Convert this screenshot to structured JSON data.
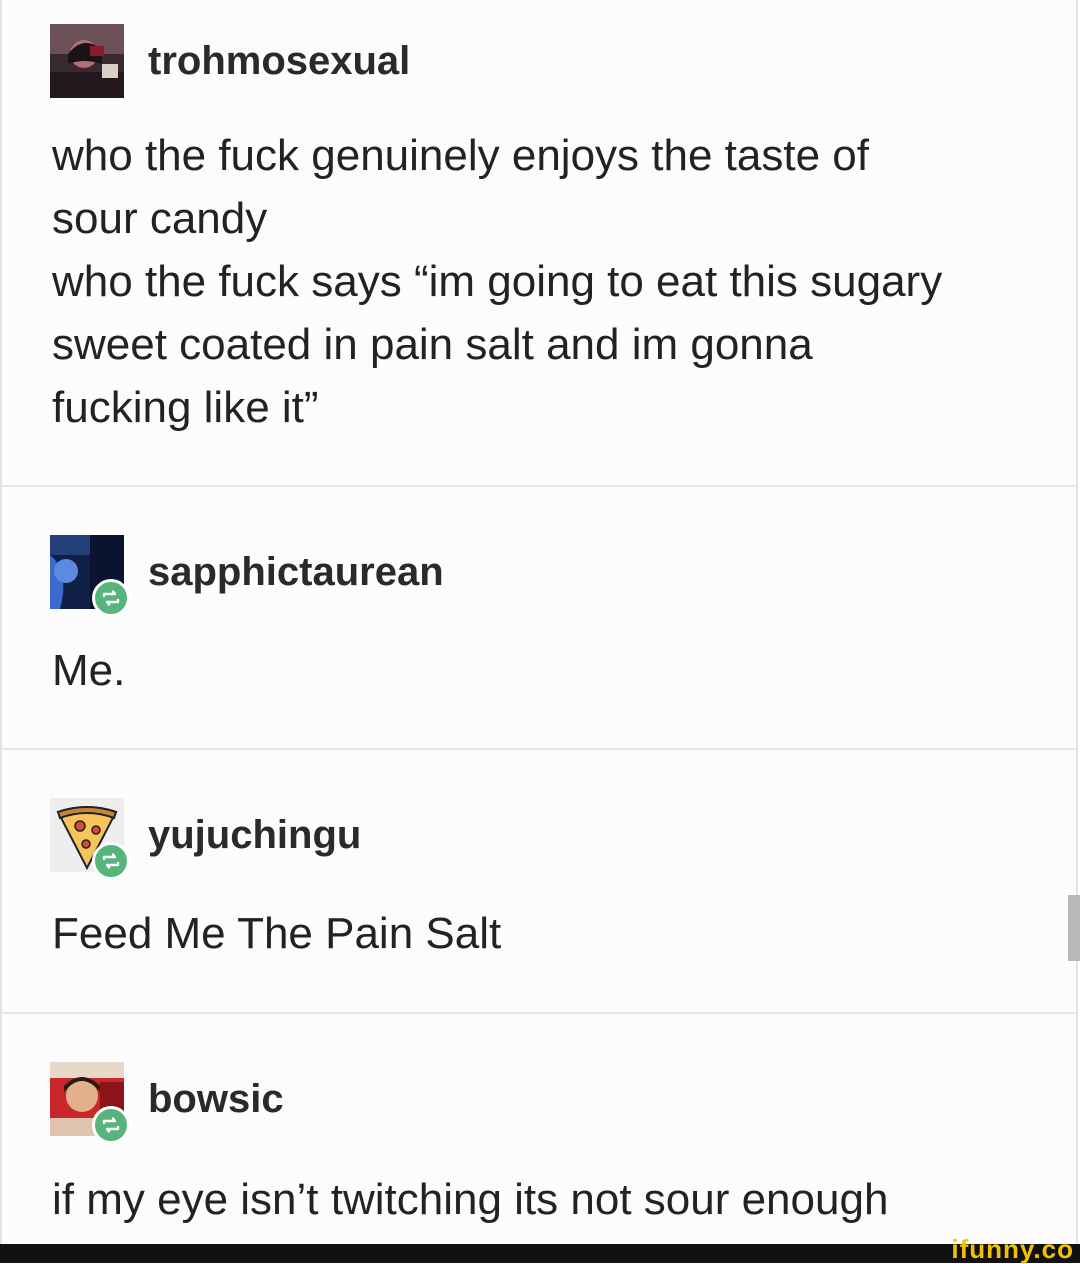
{
  "posts": [
    {
      "username": "trohmosexual",
      "text": "who the fuck genuinely enjoys the taste of\nsour candy\nwho the fuck says “im going to eat this sugary\nsweet coated in pain salt and im gonna\nfucking like it”",
      "avatar_icon": "user-photo-avatar",
      "reblog": false
    },
    {
      "username": "sapphictaurean",
      "text": "Me.",
      "avatar_icon": "blue-photo-avatar",
      "reblog": true
    },
    {
      "username": "yujuchingu",
      "text": "Feed Me The Pain Salt",
      "avatar_icon": "pizza-slice-avatar",
      "reblog": true
    },
    {
      "username": "bowsic",
      "text": "if my eye isn’t twitching its not sour enough",
      "avatar_icon": "red-photo-avatar",
      "reblog": true
    }
  ],
  "watermark": "ifunny.co",
  "colors": {
    "reblog_badge": "#56b47c",
    "divider": "#e6e6e6",
    "watermark": "#f2c200"
  }
}
